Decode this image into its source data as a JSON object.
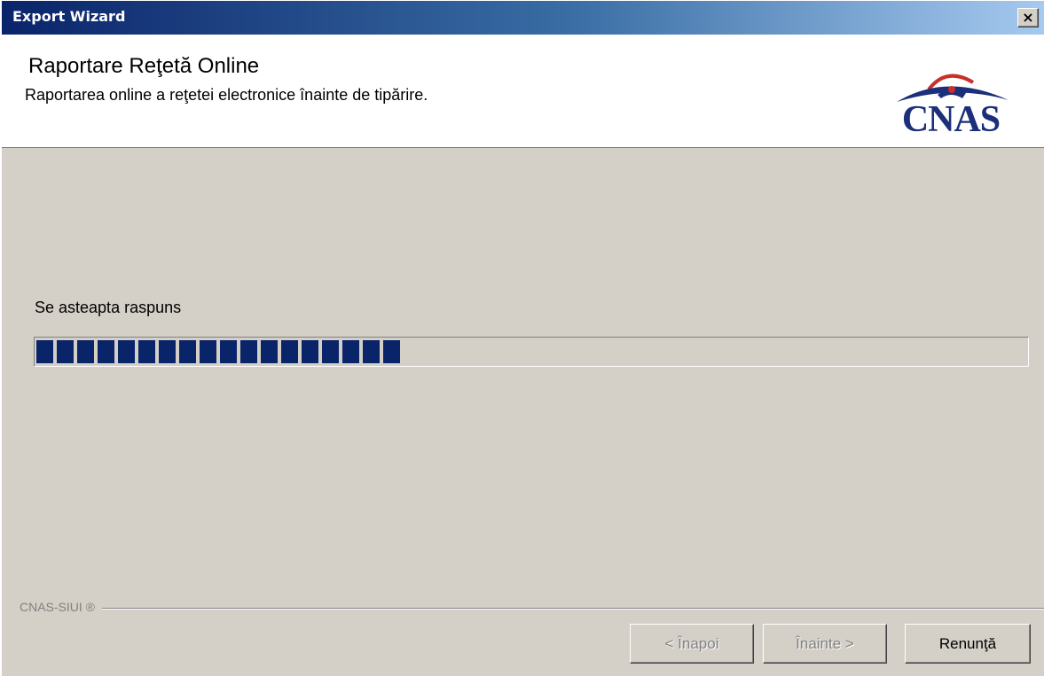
{
  "window": {
    "title": "Export Wizard",
    "close_label": "×"
  },
  "header": {
    "title": "Raportare Reţetă Online",
    "subtitle": "Raportarea online a reţetei electronice înainte de tipărire.",
    "logo": {
      "text": "CNAS",
      "icon": "cnas-house-logo"
    }
  },
  "status": {
    "label": "Se asteapta raspuns",
    "progress_fraction": 0.37
  },
  "footer": {
    "brand": "CNAS-SIUI ®",
    "buttons": {
      "back": "< Înapoi",
      "next": "Înainte >",
      "cancel": "Renunţă"
    }
  },
  "colors": {
    "title_gradient_start": "#0a246a",
    "progress_block": "#0a246a",
    "window_bg": "#d4d0c8",
    "logo_blue": "#1b2f7a",
    "logo_red": "#c8302a"
  }
}
